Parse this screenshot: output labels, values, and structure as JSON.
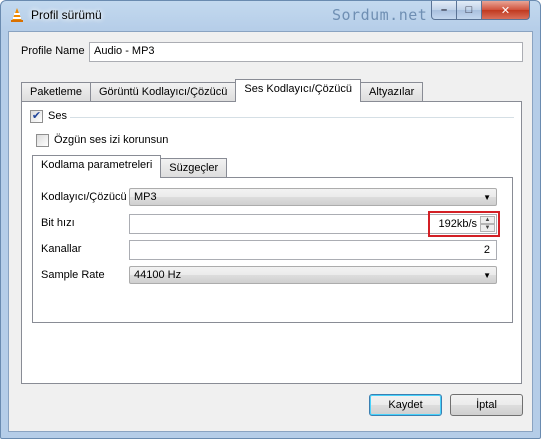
{
  "window": {
    "title": "Profil sürümü",
    "watermark": "Sordum.net",
    "controls": {
      "minimize": "–",
      "maximize": "□",
      "close": "✕"
    }
  },
  "profile": {
    "label": "Profile Name",
    "value": "Audio - MP3"
  },
  "tabs": [
    {
      "label": "Paketleme",
      "active": false
    },
    {
      "label": "Görüntü Kodlayıcı/Çözücü",
      "active": false
    },
    {
      "label": "Ses Kodlayıcı/Çözücü",
      "active": true
    },
    {
      "label": "Altyazılar",
      "active": false
    }
  ],
  "audio": {
    "ses_label": "Ses",
    "ses_checked": true,
    "keep_original_label": "Özgün ses izi korunsun",
    "keep_original_checked": false
  },
  "subtabs": [
    {
      "label": "Kodlama parametreleri",
      "active": true
    },
    {
      "label": "Süzgeçler",
      "active": false
    }
  ],
  "params": {
    "codec_label": "Kodlayıcı/Çözücü",
    "codec_value": "MP3",
    "bitrate_label": "Bit hızı",
    "bitrate_value": "192kb/s",
    "channels_label": "Kanallar",
    "channels_value": "2",
    "samplerate_label": "Sample Rate",
    "samplerate_value": "44100 Hz"
  },
  "buttons": {
    "save": "Kaydet",
    "cancel": "İptal"
  },
  "colors": {
    "highlight": "#d31f25",
    "title_bg": "#b5cde8"
  },
  "icons": {
    "app": "vlc-cone-icon",
    "dropdown": "chevron-down-icon"
  }
}
